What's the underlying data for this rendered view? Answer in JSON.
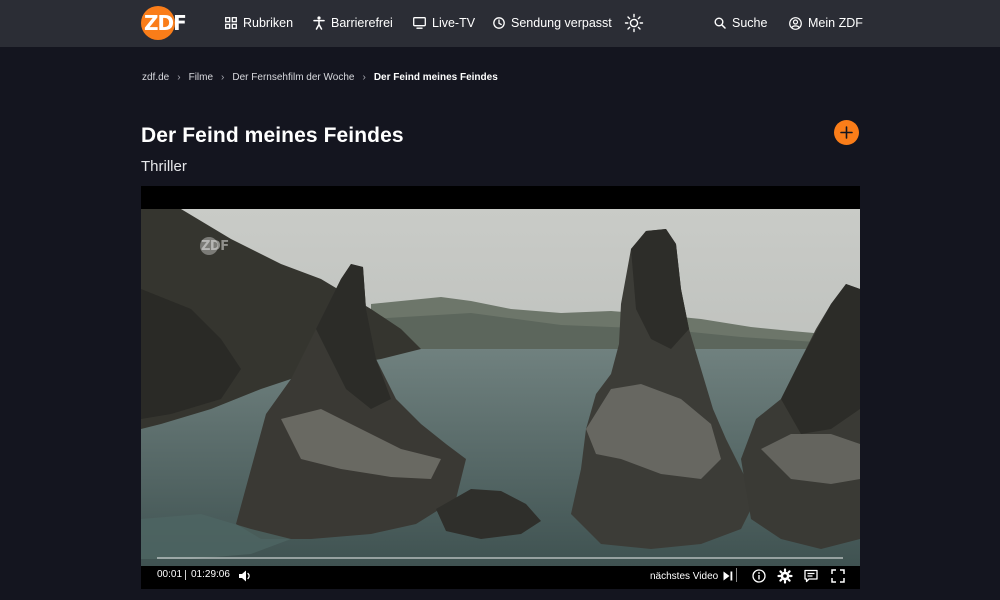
{
  "header": {
    "logo_text": "ZDF",
    "nav": [
      {
        "label": "Rubriken"
      },
      {
        "label": "Barrierefrei"
      },
      {
        "label": "Live-TV"
      },
      {
        "label": "Sendung verpasst"
      }
    ],
    "search_label": "Suche",
    "account_label": "Mein ZDF"
  },
  "breadcrumb": [
    {
      "label": "zdf.de"
    },
    {
      "label": "Filme"
    },
    {
      "label": "Der Fernsehfilm der Woche"
    },
    {
      "label": "Der Feind meines Feindes"
    }
  ],
  "content": {
    "title": "Der Feind meines Feindes",
    "genre": "Thriller"
  },
  "player": {
    "watermark": "ZDF",
    "current_time": "00:01",
    "duration": "01:29:06",
    "progress": 0.0,
    "next_video_label": "nächstes Video"
  },
  "colors": {
    "brand_orange": "#fa7d19",
    "page_background": "#14151f",
    "header_background": "#2b2d35"
  },
  "icons": {
    "logo": "zdf-logo",
    "rubriken": "grid-icon",
    "barrierefrei": "accessibility-icon",
    "live_tv": "tv-icon",
    "sendung_verpasst": "clock-icon",
    "theme": "sun-icon",
    "search": "search-icon",
    "account": "user-icon",
    "add": "plus-icon",
    "volume": "volume-icon",
    "next": "skip-next-icon",
    "info": "info-icon",
    "settings": "gear-icon",
    "subtitles": "subtitles-icon",
    "fullscreen": "fullscreen-icon"
  }
}
